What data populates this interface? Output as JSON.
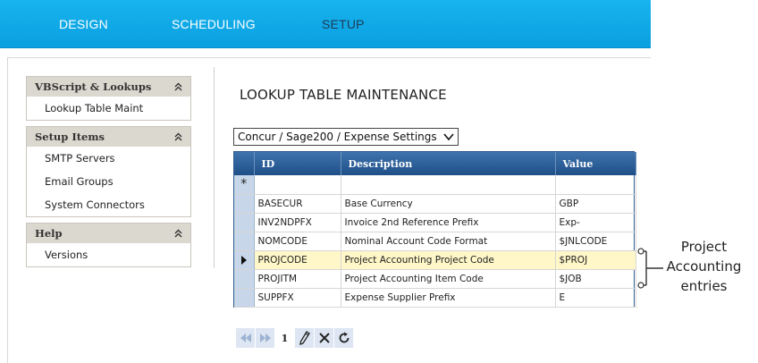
{
  "nav": {
    "items": [
      {
        "label": "DESIGN"
      },
      {
        "label": "SCHEDULING"
      },
      {
        "label": "SETUP"
      }
    ]
  },
  "sidebar": {
    "groups": [
      {
        "title": "VBScript & Lookups",
        "items": [
          "Lookup Table Maint"
        ]
      },
      {
        "title": "Setup Items",
        "items": [
          "SMTP Servers",
          "Email Groups",
          "System Connectors"
        ]
      },
      {
        "title": "Help",
        "items": [
          "Versions"
        ]
      }
    ]
  },
  "main": {
    "title": "LOOKUP TABLE MAINTENANCE",
    "table_select": "Concur / Sage200 / Expense Settings"
  },
  "grid": {
    "columns": [
      "ID",
      "Description",
      "Value"
    ],
    "rows": [
      {
        "id": "BASECUR",
        "description": "Base Currency",
        "value": "GBP"
      },
      {
        "id": "INV2NDPFX",
        "description": "Invoice 2nd Reference Prefix",
        "value": "Exp-"
      },
      {
        "id": "NOMCODE",
        "description": "Nominal Account Code Format",
        "value": "$JNLCODE"
      },
      {
        "id": "PROJCODE",
        "description": "Project Accounting Project Code",
        "value": "$PROJ"
      },
      {
        "id": "PROJITM",
        "description": "Project Accounting Item Code",
        "value": "$JOB"
      },
      {
        "id": "SUPPFX",
        "description": "Expense Supplier Prefix",
        "value": "E"
      }
    ],
    "new_row_marker": "*",
    "current_row_index": 3
  },
  "pager": {
    "page": "1",
    "icons": [
      "first-page-icon",
      "prev-page-icon",
      "edit-icon",
      "delete-icon",
      "refresh-icon"
    ]
  },
  "callout": {
    "line1": "Project",
    "line2": "Accounting",
    "line3": "entries"
  },
  "colors": {
    "nav_bg": "#0fa8e8",
    "grid_header": "#2a5b93",
    "current_row": "#fff7c8"
  }
}
